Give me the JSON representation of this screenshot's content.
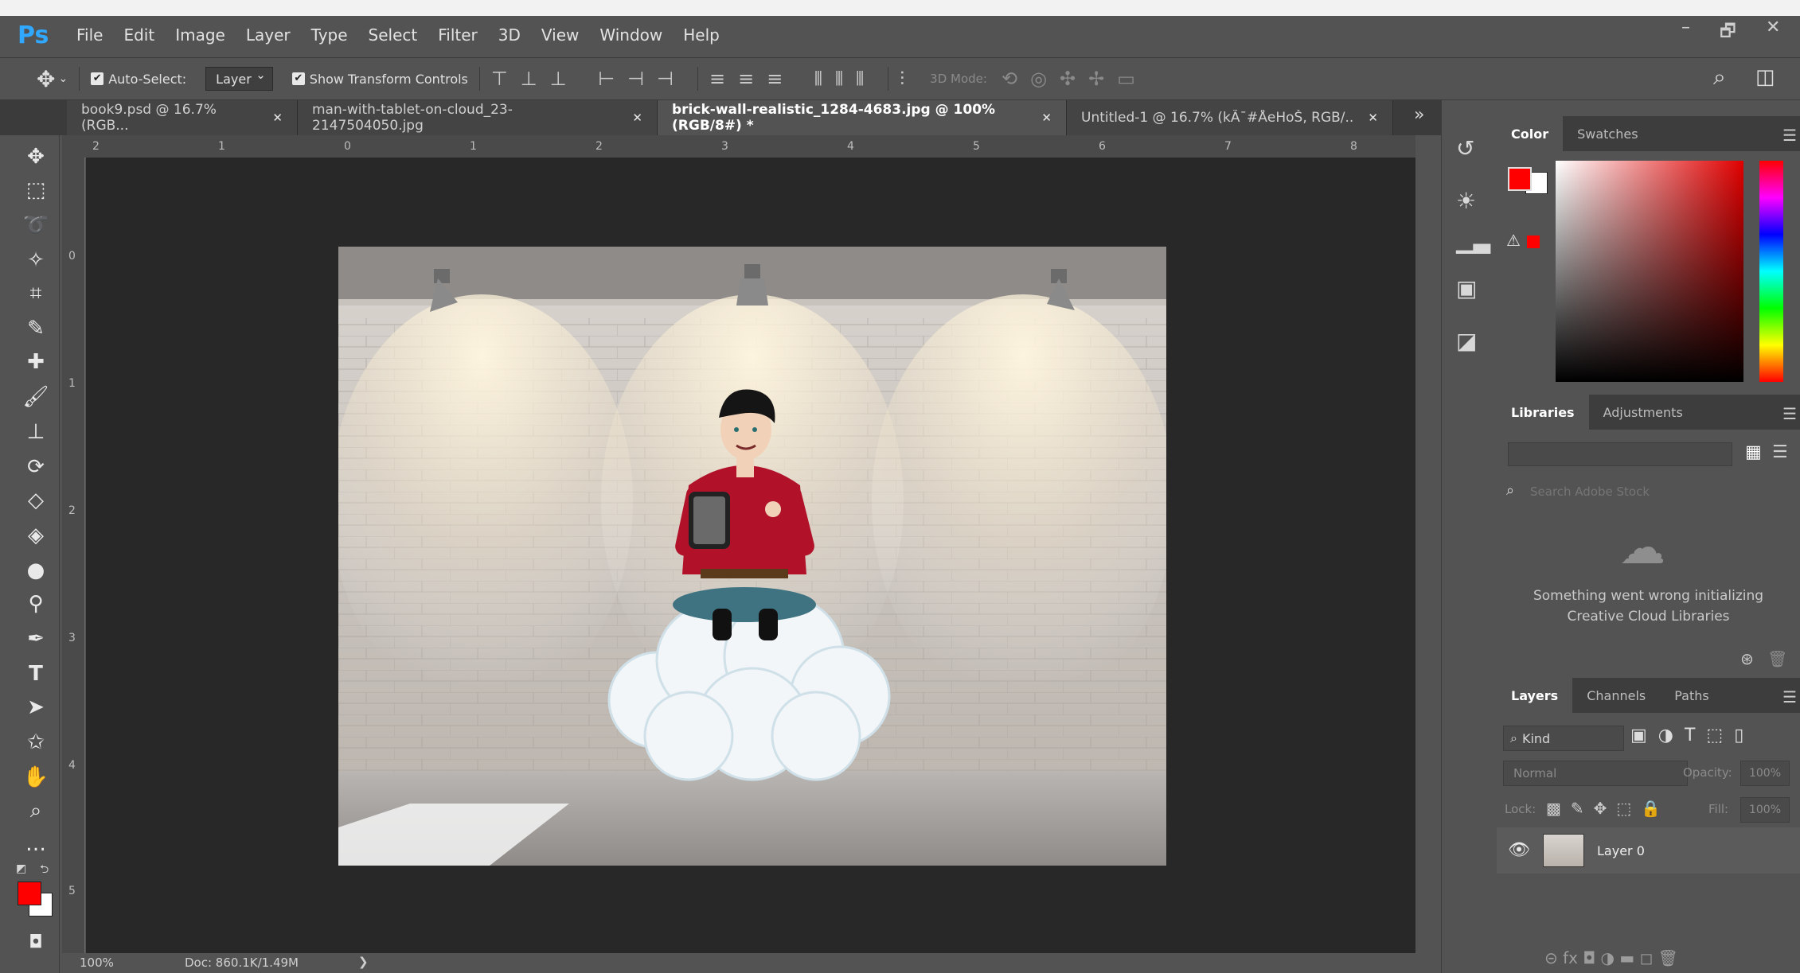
{
  "app": {
    "logo": "Ps"
  },
  "menu": [
    "File",
    "Edit",
    "Image",
    "Layer",
    "Type",
    "Select",
    "Filter",
    "3D",
    "View",
    "Window",
    "Help"
  ],
  "window_controls": {
    "minimize": "–",
    "restore": "🗗",
    "close": "✕"
  },
  "options": {
    "auto_select_label": "Auto-Select:",
    "auto_select_checked": true,
    "auto_select_target": "Layer",
    "show_transform_label": "Show Transform Controls",
    "show_transform_checked": true,
    "mode_3d_label": "3D Mode:"
  },
  "tabs": [
    {
      "label": "book9.psd @ 16.7% (RGB...",
      "close": "✕",
      "active": false
    },
    {
      "label": "man-with-tablet-on-cloud_23-2147504050.jpg",
      "close": "✕",
      "active": false
    },
    {
      "label": "brick-wall-realistic_1284-4683.jpg @ 100% (RGB/8#) *",
      "close": "✕",
      "active": true
    },
    {
      "label": "Untitled-1 @ 16.7% (kÃ¯#ÅeHoŠ, RGB/...",
      "close": "✕",
      "active": false
    }
  ],
  "tabs_overflow": "»",
  "ruler": {
    "h": [
      "2",
      "1",
      "0",
      "1",
      "2",
      "3",
      "4",
      "5",
      "6",
      "7",
      "8"
    ],
    "v": [
      "0",
      "1",
      "2",
      "3",
      "4",
      "5"
    ]
  },
  "status": {
    "zoom": "100%",
    "doc": "Doc: 860.1K/1.49M",
    "arrow": "❯"
  },
  "panels": {
    "color_tabs": [
      "Color",
      "Swatches"
    ],
    "libraries_tabs": [
      "Libraries",
      "Adjustments"
    ],
    "libraries_search_placeholder": "Search Adobe Stock",
    "libraries_error_line1": "Something went wrong initializing",
    "libraries_error_line2": "Creative Cloud Libraries",
    "layers_tabs": [
      "Layers",
      "Channels",
      "Paths"
    ],
    "layers_kind": "Kind",
    "blend_mode": "Normal",
    "opacity_label": "Opacity:",
    "opacity_value": "100%",
    "lock_label": "Lock:",
    "fill_label": "Fill:",
    "fill_value": "100%",
    "layer_name": "Layer 0",
    "footer_icons": "⊝  fx  ◘  ◑  ▬  ◻  🗑"
  },
  "colors": {
    "foreground": "#ff0000",
    "background": "#ffffff",
    "ps_blue": "#31a8ff"
  }
}
